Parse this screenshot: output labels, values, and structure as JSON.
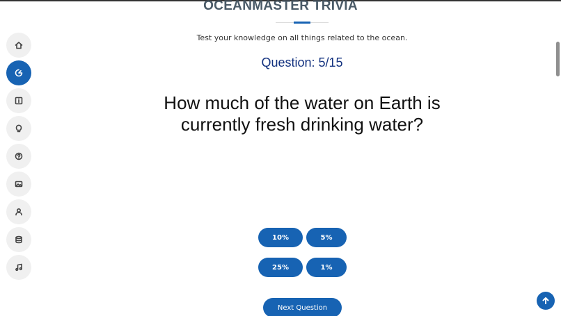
{
  "header": {
    "title": "OCEANMASTER TRIVIA",
    "subtitle": "Test your knowledge on all things related to the ocean."
  },
  "quiz": {
    "question_counter": "Question: 5/15",
    "question": "How much of the water on Earth is currently fresh drinking water?",
    "answers": [
      "10%",
      "5%",
      "25%",
      "1%"
    ],
    "next_label": "Next Question"
  },
  "sidebar": {
    "items": [
      {
        "icon": "home-icon",
        "active": false
      },
      {
        "icon": "pie-chart-icon",
        "active": true
      },
      {
        "icon": "info-icon",
        "active": false
      },
      {
        "icon": "lightbulb-icon",
        "active": false
      },
      {
        "icon": "help-icon",
        "active": false
      },
      {
        "icon": "image-icon",
        "active": false
      },
      {
        "icon": "user-icon",
        "active": false
      },
      {
        "icon": "database-icon",
        "active": false
      },
      {
        "icon": "music-icon",
        "active": false
      }
    ]
  },
  "colors": {
    "accent": "#1763b3",
    "title": "#4a5a67",
    "question_counter": "#12317f"
  }
}
